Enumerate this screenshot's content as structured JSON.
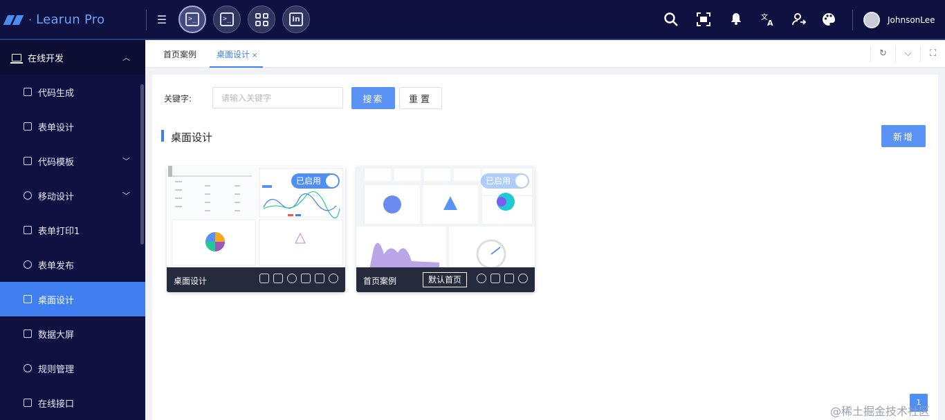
{
  "app": {
    "title": "Learun Pro"
  },
  "user": {
    "name": "JohnsonLee"
  },
  "sidebar": {
    "group": "在线开发",
    "items": [
      {
        "label": "代码生成"
      },
      {
        "label": "表单设计"
      },
      {
        "label": "代码模板"
      },
      {
        "label": "移动设计"
      },
      {
        "label": "表单打印1"
      },
      {
        "label": "表单发布"
      },
      {
        "label": "桌面设计"
      },
      {
        "label": "数据大屏"
      },
      {
        "label": "规则管理"
      },
      {
        "label": "在线接口"
      }
    ]
  },
  "tabs": [
    {
      "label": "首页案例"
    },
    {
      "label": "桌面设计",
      "close": "×"
    }
  ],
  "search": {
    "keyword_label": "关键字:",
    "placeholder": "请输入关键字",
    "search_label": "搜索",
    "reset_label": "重置"
  },
  "section": {
    "title": "桌面设计",
    "add_label": "新增"
  },
  "cards": [
    {
      "name": "桌面设计",
      "status": "已启用"
    },
    {
      "name": "首页案例",
      "status": "已启用",
      "default_tag": "默认首页"
    }
  ],
  "pager": {
    "page": "1"
  },
  "watermark": "@稀土掘金技术社区",
  "colors": {
    "topbar": "#0f1140",
    "accent": "#3f7ff0",
    "card_footer": "#252a3c"
  },
  "icons": [
    "menu-toggle-icon",
    "terminal-icon",
    "grid-icon",
    "linkedin-icon",
    "search-icon",
    "scan-icon",
    "bell-icon",
    "translate-icon",
    "user-switch-icon",
    "palette-icon"
  ]
}
